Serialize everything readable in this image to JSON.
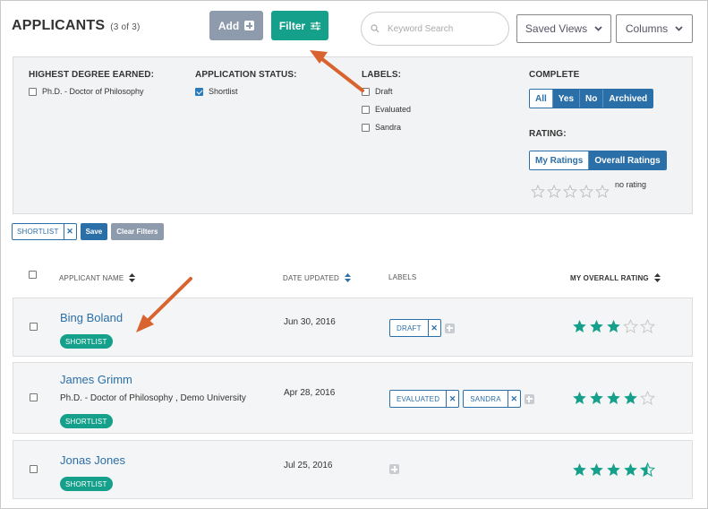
{
  "header": {
    "title": "APPLICANTS",
    "count": "(3 of 3)",
    "add_label": "Add",
    "filter_label": "Filter",
    "search_placeholder": "Keyword Search",
    "saved_views_label": "Saved Views",
    "columns_label": "Columns"
  },
  "filters": {
    "degree": {
      "title": "HIGHEST DEGREE EARNED:",
      "options": [
        {
          "label": "Ph.D. - Doctor of Philosophy",
          "checked": false
        }
      ]
    },
    "status": {
      "title": "APPLICATION STATUS:",
      "options": [
        {
          "label": "Shortlist",
          "checked": true
        }
      ]
    },
    "labels": {
      "title": "LABELS:",
      "options": [
        {
          "label": "Draft",
          "checked": false
        },
        {
          "label": "Evaluated",
          "checked": false
        },
        {
          "label": "Sandra",
          "checked": false
        }
      ]
    },
    "complete": {
      "title": "COMPLETE",
      "options": [
        "All",
        "Yes",
        "No",
        "Archived"
      ],
      "selected": "All"
    },
    "rating": {
      "title": "RATING:",
      "options": [
        "My Ratings",
        "Overall Ratings"
      ],
      "selected": "My Ratings",
      "stars": 0,
      "no_rating_label": "no rating"
    }
  },
  "active_filters": {
    "chips": [
      "SHORTLIST"
    ],
    "save_label": "Save",
    "clear_label": "Clear Filters"
  },
  "table": {
    "columns": {
      "name": "APPLICANT NAME",
      "date": "DATE UPDATED",
      "labels": "LABELS",
      "rating": "MY OVERALL RATING"
    },
    "rows": [
      {
        "name": "Bing Boland",
        "degree": "",
        "status": "SHORTLIST",
        "date": "Jun 30, 2016",
        "labels": [
          "DRAFT"
        ],
        "rating": 3
      },
      {
        "name": "James Grimm",
        "degree": "Ph.D. - Doctor of Philosophy , Demo University",
        "status": "SHORTLIST",
        "date": "Apr 28, 2016",
        "labels": [
          "EVALUATED",
          "SANDRA"
        ],
        "rating": 4
      },
      {
        "name": "Jonas Jones",
        "degree": "",
        "status": "SHORTLIST",
        "date": "Jul 25, 2016",
        "labels": [],
        "rating": 4.5
      }
    ]
  },
  "colors": {
    "accent": "#14a08a",
    "primary": "#2b6fa8",
    "muted": "#8e9bac",
    "arrow": "#d9632e"
  }
}
